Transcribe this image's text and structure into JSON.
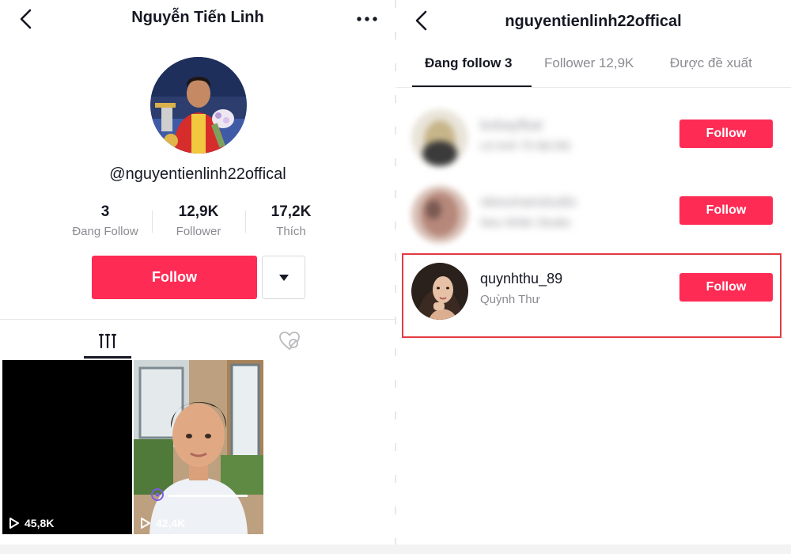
{
  "left": {
    "title": "Nguyễn Tiến Linh",
    "handle": "@nguyentienlinh22offical",
    "stats": [
      {
        "value": "3",
        "label": "Đang Follow"
      },
      {
        "value": "12,9K",
        "label": "Follower"
      },
      {
        "value": "17,2K",
        "label": "Thích"
      }
    ],
    "follow_label": "Follow",
    "videos": [
      {
        "views": "45,8K"
      },
      {
        "views": "42,4K"
      }
    ]
  },
  "right": {
    "title": "nguyentienlinh22offical",
    "tabs": [
      {
        "label": "Đang follow 3",
        "active": true
      },
      {
        "label": "Follower 12,9K",
        "active": false
      },
      {
        "label": "Được đề xuất",
        "active": false
      }
    ],
    "accounts": [
      {
        "username": "bobayfbat",
        "display_name": "Lê Anh Tô Bá Độ",
        "follow_label": "Follow",
        "blurred": true
      },
      {
        "username": "okeumanstudio",
        "display_name": "Neu Nhãn Studio",
        "follow_label": "Follow",
        "blurred": true
      },
      {
        "username": "quynhthu_89",
        "display_name": "Quỳnh Thư",
        "follow_label": "Follow",
        "blurred": false
      }
    ]
  },
  "colors": {
    "accent": "#fe2c55",
    "highlight_border": "#e33a42",
    "secondary_text": "#8a8b91"
  },
  "icons": [
    "chevron-left-icon",
    "more-dots-icon",
    "caret-down-icon",
    "grid-videos-icon",
    "liked-heart-icon",
    "play-icon"
  ]
}
